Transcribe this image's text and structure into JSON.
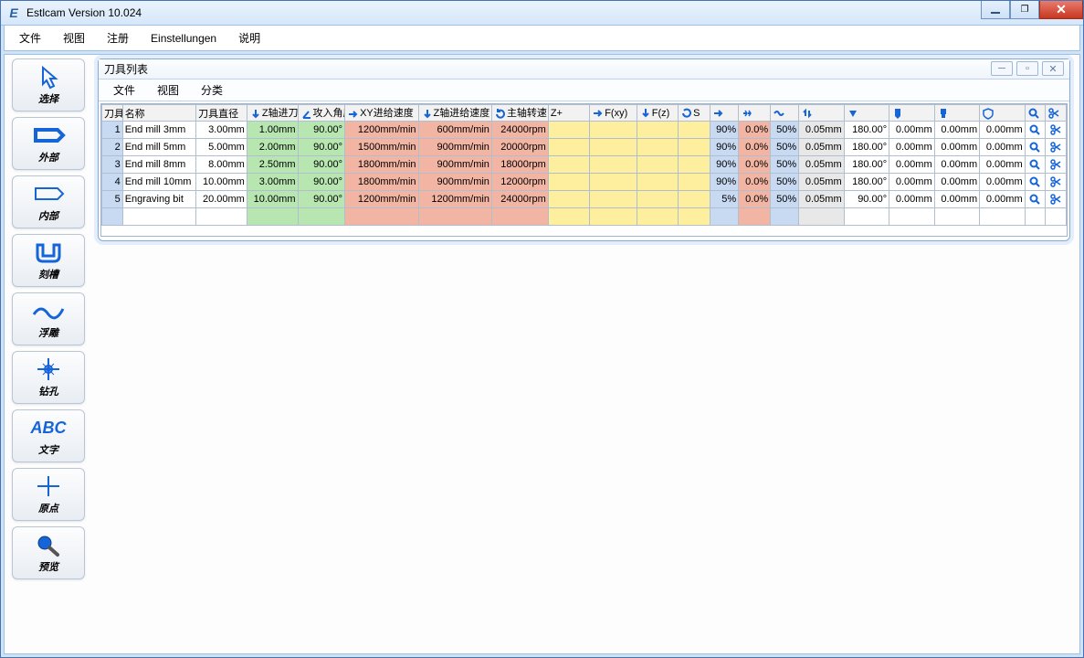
{
  "window": {
    "title": "Estlcam Version 10.024"
  },
  "menu": {
    "items": [
      "文件",
      "视图",
      "注册",
      "Einstellungen",
      "说明"
    ]
  },
  "toolbar": [
    {
      "key": "select",
      "label": "选择"
    },
    {
      "key": "outside",
      "label": "外部"
    },
    {
      "key": "inside",
      "label": "内部"
    },
    {
      "key": "engrave",
      "label": "刻槽"
    },
    {
      "key": "carve",
      "label": "浮雕"
    },
    {
      "key": "drill",
      "label": "钻孔"
    },
    {
      "key": "text",
      "label": "文字"
    },
    {
      "key": "origin",
      "label": "原点"
    },
    {
      "key": "preview",
      "label": "预览"
    }
  ],
  "subwindow": {
    "title": "刀具列表",
    "menu": [
      "文件",
      "视图",
      "分类"
    ],
    "headers": {
      "num": "刀具编号",
      "name": "名称",
      "dia": "刀具直径",
      "z": "Z轴进刀深度",
      "ang": "攻入角度",
      "xy": "XY进给速度",
      "zf": "Z轴进给速度",
      "spd": "主轴转速",
      "zplus": "Z+",
      "fxy": "F(xy)",
      "fz": "F(z)",
      "s": "S",
      "ov1": "",
      "ov2": "",
      "ov3": "",
      "ov4": "",
      "a2": "",
      "m1": "",
      "m2": "",
      "m3": "",
      "search": "",
      "scissors": ""
    },
    "rows": [
      {
        "n": "1",
        "name": "End mill 3mm",
        "dia": "3.00mm",
        "z": "1.00mm",
        "ang": "90.00°",
        "xy": "1200mm/min",
        "zf": "600mm/min",
        "spd": "24000rpm",
        "y1": "",
        "y2": "",
        "y3": "",
        "y4": "",
        "p1": "90%",
        "p2": "0.0%",
        "p3": "50%",
        "g1": "0.05mm",
        "a2": "180.00°",
        "m1": "0.00mm",
        "m2": "0.00mm",
        "m3": "0.00mm"
      },
      {
        "n": "2",
        "name": "End mill 5mm",
        "dia": "5.00mm",
        "z": "2.00mm",
        "ang": "90.00°",
        "xy": "1500mm/min",
        "zf": "900mm/min",
        "spd": "20000rpm",
        "y1": "",
        "y2": "",
        "y3": "",
        "y4": "",
        "p1": "90%",
        "p2": "0.0%",
        "p3": "50%",
        "g1": "0.05mm",
        "a2": "180.00°",
        "m1": "0.00mm",
        "m2": "0.00mm",
        "m3": "0.00mm"
      },
      {
        "n": "3",
        "name": "End mill 8mm",
        "dia": "8.00mm",
        "z": "2.50mm",
        "ang": "90.00°",
        "xy": "1800mm/min",
        "zf": "900mm/min",
        "spd": "18000rpm",
        "y1": "",
        "y2": "",
        "y3": "",
        "y4": "",
        "p1": "90%",
        "p2": "0.0%",
        "p3": "50%",
        "g1": "0.05mm",
        "a2": "180.00°",
        "m1": "0.00mm",
        "m2": "0.00mm",
        "m3": "0.00mm"
      },
      {
        "n": "4",
        "name": "End mill 10mm",
        "dia": "10.00mm",
        "z": "3.00mm",
        "ang": "90.00°",
        "xy": "1800mm/min",
        "zf": "900mm/min",
        "spd": "12000rpm",
        "y1": "",
        "y2": "",
        "y3": "",
        "y4": "",
        "p1": "90%",
        "p2": "0.0%",
        "p3": "50%",
        "g1": "0.05mm",
        "a2": "180.00°",
        "m1": "0.00mm",
        "m2": "0.00mm",
        "m3": "0.00mm"
      },
      {
        "n": "5",
        "name": "Engraving bit",
        "dia": "20.00mm",
        "z": "10.00mm",
        "ang": "90.00°",
        "xy": "1200mm/min",
        "zf": "1200mm/min",
        "spd": "24000rpm",
        "y1": "",
        "y2": "",
        "y3": "",
        "y4": "",
        "p1": "5%",
        "p2": "0.0%",
        "p3": "50%",
        "g1": "0.05mm",
        "a2": "90.00°",
        "m1": "0.00mm",
        "m2": "0.00mm",
        "m3": "0.00mm"
      }
    ]
  }
}
